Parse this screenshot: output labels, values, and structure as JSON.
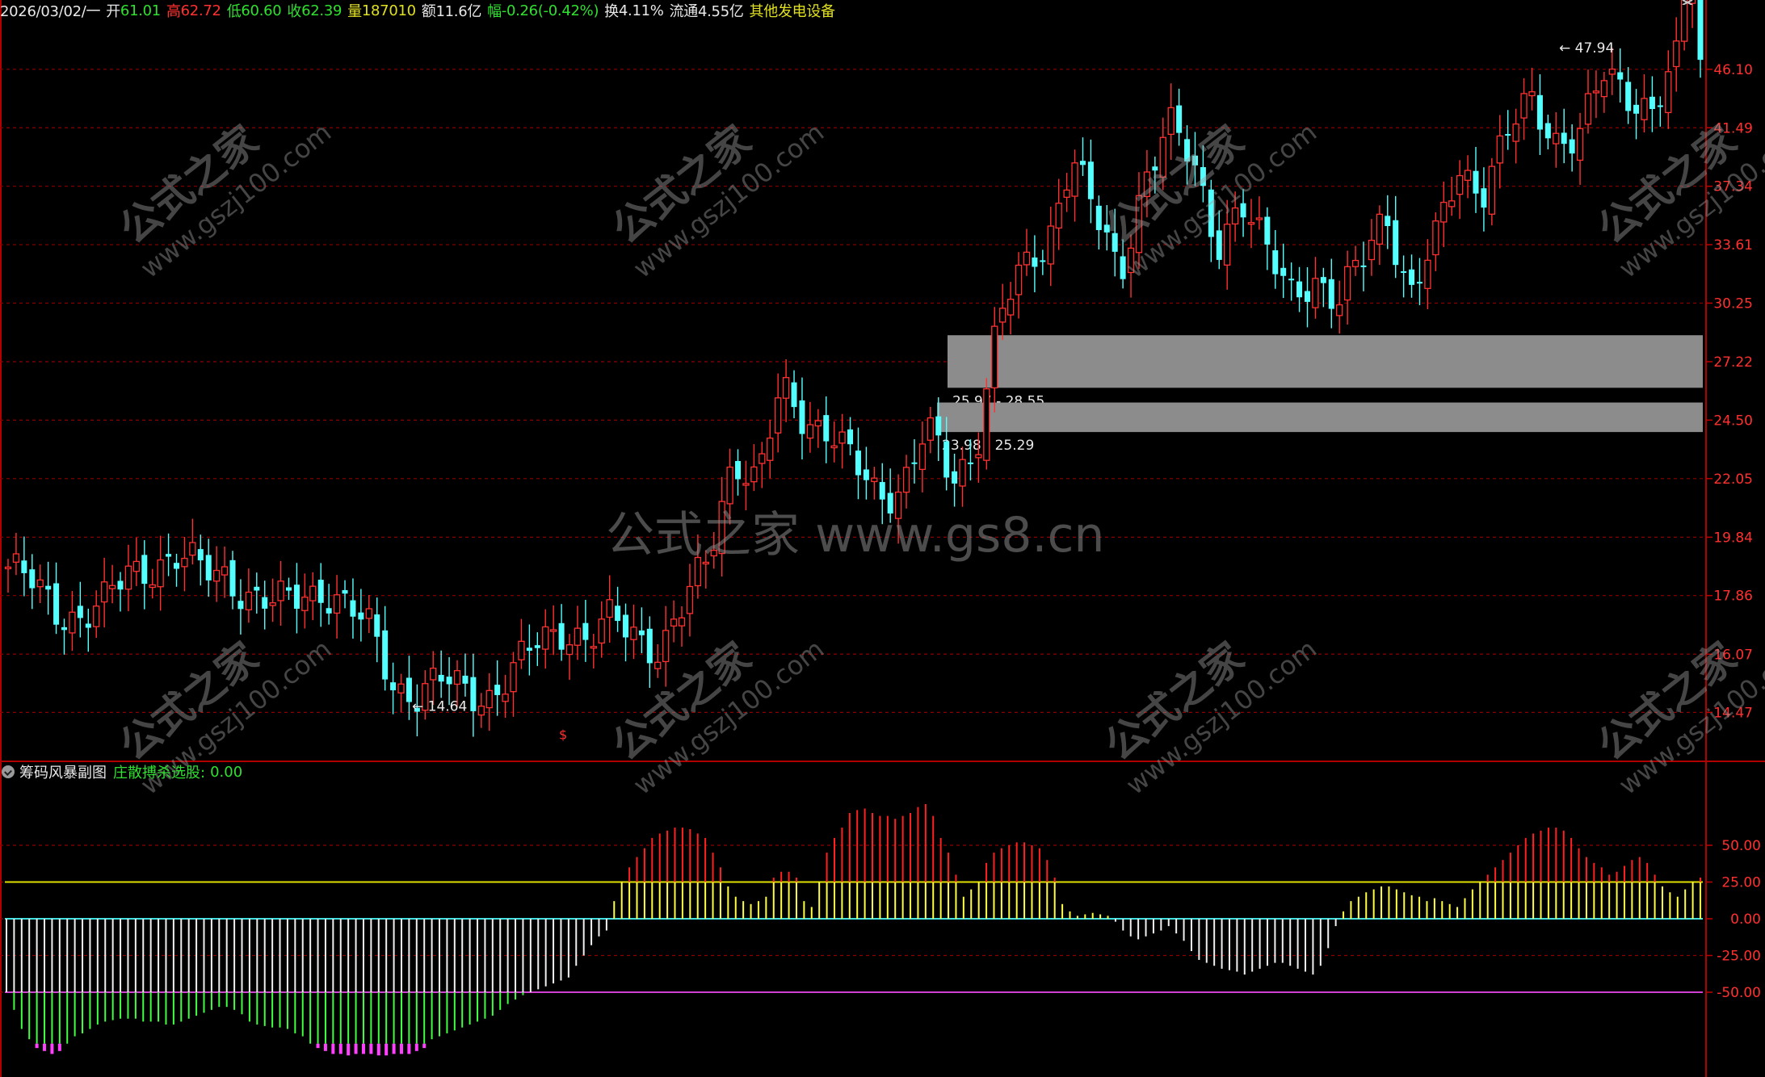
{
  "header": {
    "date": "2026/03/02/一",
    "open_label": "开",
    "open": "61.01",
    "high_label": "高",
    "high": "62.72",
    "low_label": "低",
    "low": "60.60",
    "close_label": "收",
    "close": "62.39",
    "volume_label": "量",
    "volume": "187010",
    "amount_label": "额",
    "amount": "11.6亿",
    "change_label": "幅",
    "change": "-0.26(-0.42%)",
    "turnover_label": "换",
    "turnover": "4.11%",
    "float_label": "流通",
    "float": "4.55亿",
    "sector": "其他发电设备"
  },
  "subchart": {
    "title": "筹码风暴副图",
    "signal_label": "庄散搏杀选股:",
    "signal_value": "0.00"
  },
  "watermark": {
    "center_text": "公式之家 www.gs8.cn",
    "tile_text": "公式之家",
    "tile_url": "www.gszj100.com"
  },
  "colors": {
    "background": "#000000",
    "up": "#ff3030",
    "down": "#54ffff",
    "grid": "#8b0000",
    "zone_fill": "#8c8c8c",
    "osc_yellow": "#ffff40",
    "osc_red": "#ff2020",
    "osc_white": "#f0f0f0",
    "osc_green": "#40ff40",
    "osc_magenta": "#ff40ff",
    "line_yellow": "#e0e000",
    "line_cyan": "#40e0e0",
    "line_magenta": "#d040d0"
  },
  "chart_data": [
    {
      "type": "candlestick",
      "title": "",
      "y_ticks": [
        46.1,
        41.49,
        37.34,
        33.61,
        30.25,
        27.22,
        24.5,
        22.05,
        19.84,
        17.86,
        16.07,
        14.47
      ],
      "ylim": [
        13.6,
        50.0
      ],
      "scale": "log",
      "grid": true,
      "annotations": [
        {
          "text": "47.94",
          "price": 47.94,
          "marker": "←"
        },
        {
          "text": "14.64",
          "price": 14.64,
          "marker": "←"
        }
      ],
      "zones": [
        {
          "label": "25.97 - 28.55",
          "low": 25.97,
          "high": 28.55
        },
        {
          "label": "23.98 - 25.29",
          "low": 23.98,
          "high": 25.29
        }
      ],
      "markers": [
        {
          "text": "$",
          "near_price": 14.2
        }
      ],
      "bars_closing_prices_approx": [
        18.8,
        18.2,
        17.4,
        17.2,
        17.6,
        18.6,
        18.9,
        19.1,
        18.7,
        18.6,
        17.8,
        17.5,
        17.9,
        18.1,
        17.4,
        16.8,
        15.2,
        14.9,
        15.3,
        15.1,
        14.9,
        15.6,
        16.5,
        16.9,
        16.4,
        17.1,
        16.7,
        16.2,
        17.5,
        19.2,
        23.0,
        21.8,
        25.8,
        24.6,
        24.1,
        22.5,
        21.3,
        21.9,
        24.2,
        21.8,
        23.1,
        29.8,
        31.8,
        33.6,
        40.0,
        35.2,
        31.3,
        38.1,
        42.0,
        38.5,
        33.6,
        36.6,
        33.1,
        30.9,
        31.8,
        30.0,
        32.6,
        35.9,
        30.5,
        33.5,
        38.6,
        37.2,
        40.8,
        43.5,
        40.8,
        41.0,
        45.4,
        44.2,
        43.1,
        46.5,
        62.39
      ]
    },
    {
      "type": "bar",
      "title": "",
      "y_ticks": [
        50.0,
        25.0,
        0.0,
        -25.0,
        -50.0
      ],
      "ylim": [
        -105,
        95
      ],
      "reference_lines": [
        25,
        0,
        -50
      ],
      "series": [
        {
          "values": [
            -50,
            -62,
            -75,
            -82,
            -88,
            -90,
            -92,
            -90,
            -85,
            -80,
            -78,
            -75,
            -72,
            -70,
            -69,
            -68,
            -68,
            -68,
            -70,
            -70,
            -70,
            -72,
            -72,
            -70,
            -68,
            -66,
            -64,
            -62,
            -60,
            -60,
            -62,
            -65,
            -70,
            -72,
            -73,
            -74,
            -74,
            -75,
            -78,
            -80,
            -85,
            -88,
            -90,
            -92,
            -92,
            -93,
            -92,
            -92,
            -92,
            -93,
            -93,
            -92,
            -92,
            -92,
            -90,
            -88,
            -82,
            -80,
            -78,
            -76,
            -74,
            -72,
            -70,
            -68,
            -66,
            -62,
            -58,
            -55,
            -52,
            -50,
            -48,
            -46,
            -44,
            -42,
            -40,
            -32,
            -25,
            -18,
            -12,
            -8,
            12,
            25,
            35,
            42,
            48,
            55,
            58,
            60,
            62,
            62,
            61,
            58,
            55,
            45,
            35,
            22,
            15,
            12,
            10,
            12,
            15,
            28,
            32,
            32,
            28,
            12,
            8,
            25,
            45,
            55,
            62,
            72,
            74,
            75,
            72,
            70,
            70,
            68,
            70,
            72,
            76,
            78,
            70,
            55,
            45,
            30,
            15,
            20,
            25,
            38,
            45,
            48,
            50,
            52,
            52,
            50,
            48,
            40,
            28,
            10,
            5,
            2,
            3,
            4,
            3,
            2,
            -2,
            -8,
            -12,
            -14,
            -12,
            -10,
            -8,
            -5,
            -10,
            -15,
            -22,
            -28,
            -30,
            -32,
            -34,
            -35,
            -36,
            -38,
            -36,
            -34,
            -32,
            -30,
            -30,
            -32,
            -34,
            -36,
            -38,
            -32,
            -20,
            -5,
            5,
            12,
            15,
            18,
            20,
            22,
            22,
            20,
            18,
            16,
            15,
            12,
            14,
            12,
            10,
            8,
            14,
            20,
            25,
            30,
            35,
            40,
            45,
            50,
            55,
            58,
            60,
            62,
            62,
            60,
            55,
            48,
            42,
            38,
            35,
            30,
            32,
            36,
            40,
            42,
            38,
            30,
            22,
            18,
            15,
            20,
            25,
            28
          ]
        }
      ]
    }
  ]
}
